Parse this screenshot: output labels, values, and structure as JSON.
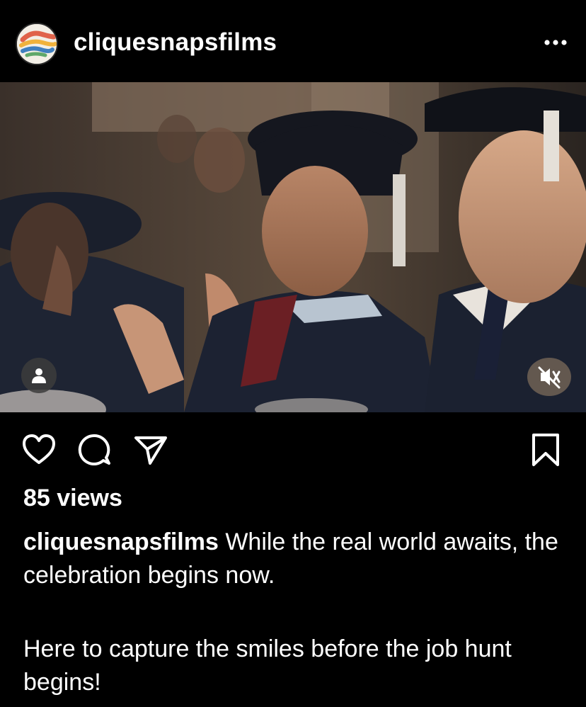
{
  "post": {
    "username": "cliquesnapsfilms",
    "more_label": "•••",
    "views": "85 views",
    "caption_user": "cliquesnapsfilms",
    "caption_line1": "While the real world awaits, the celebration begins now.",
    "caption_line2": "Here to capture the smiles before the job hunt begins!"
  },
  "icons": {
    "like": "heart-icon",
    "comment": "comment-icon",
    "share": "send-icon",
    "save": "bookmark-icon",
    "tag": "user-tag-icon",
    "mute": "speaker-muted-icon"
  },
  "colors": {
    "background": "#000000",
    "text": "#ffffff"
  }
}
